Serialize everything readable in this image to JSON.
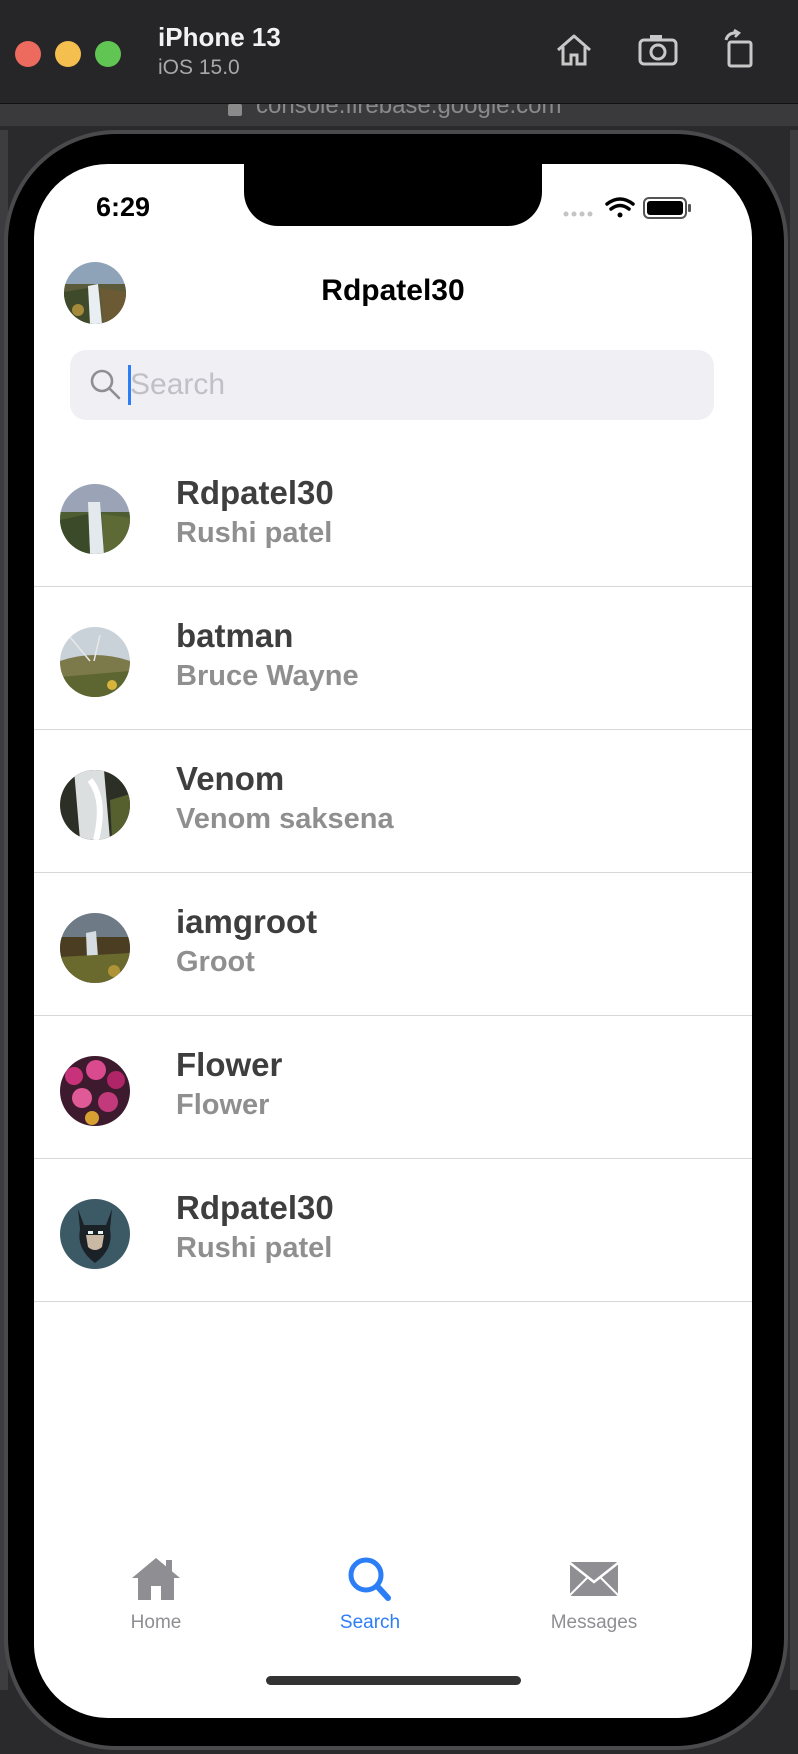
{
  "simulator": {
    "device": "iPhone 13",
    "os": "iOS 15.0",
    "buttons": [
      "home-icon",
      "screenshot-icon",
      "rotate-icon"
    ]
  },
  "background": {
    "url": "console.firebase.google.com"
  },
  "status_bar": {
    "time": "6:29"
  },
  "header": {
    "title": "Rdpatel30",
    "avatar": "waterfall-avatar"
  },
  "search": {
    "placeholder": "Search",
    "value": ""
  },
  "users": [
    {
      "username": "Rdpatel30",
      "fullname": "Rushi patel",
      "avatar": "waterfall"
    },
    {
      "username": "batman",
      "fullname": "Bruce Wayne",
      "avatar": "meadow"
    },
    {
      "username": "Venom",
      "fullname": "Venom saksena",
      "avatar": "cascade"
    },
    {
      "username": "iamgroot",
      "fullname": "Groot",
      "avatar": "waterfall-dark"
    },
    {
      "username": "Flower",
      "fullname": "Flower",
      "avatar": "flowers"
    },
    {
      "username": "Rdpatel30",
      "fullname": "Rushi patel",
      "avatar": "batman"
    }
  ],
  "tabs": [
    {
      "label": "Home",
      "icon": "house-icon",
      "active": false
    },
    {
      "label": "Search",
      "icon": "magnifier-icon",
      "active": true
    },
    {
      "label": "Messages",
      "icon": "envelope-icon",
      "active": false
    }
  ],
  "colors": {
    "accent": "#2c7ef7",
    "inactive": "#8e8e93",
    "username": "#3e3e3e",
    "fullname": "#8f8f8f",
    "search_bg": "#efeff4"
  }
}
